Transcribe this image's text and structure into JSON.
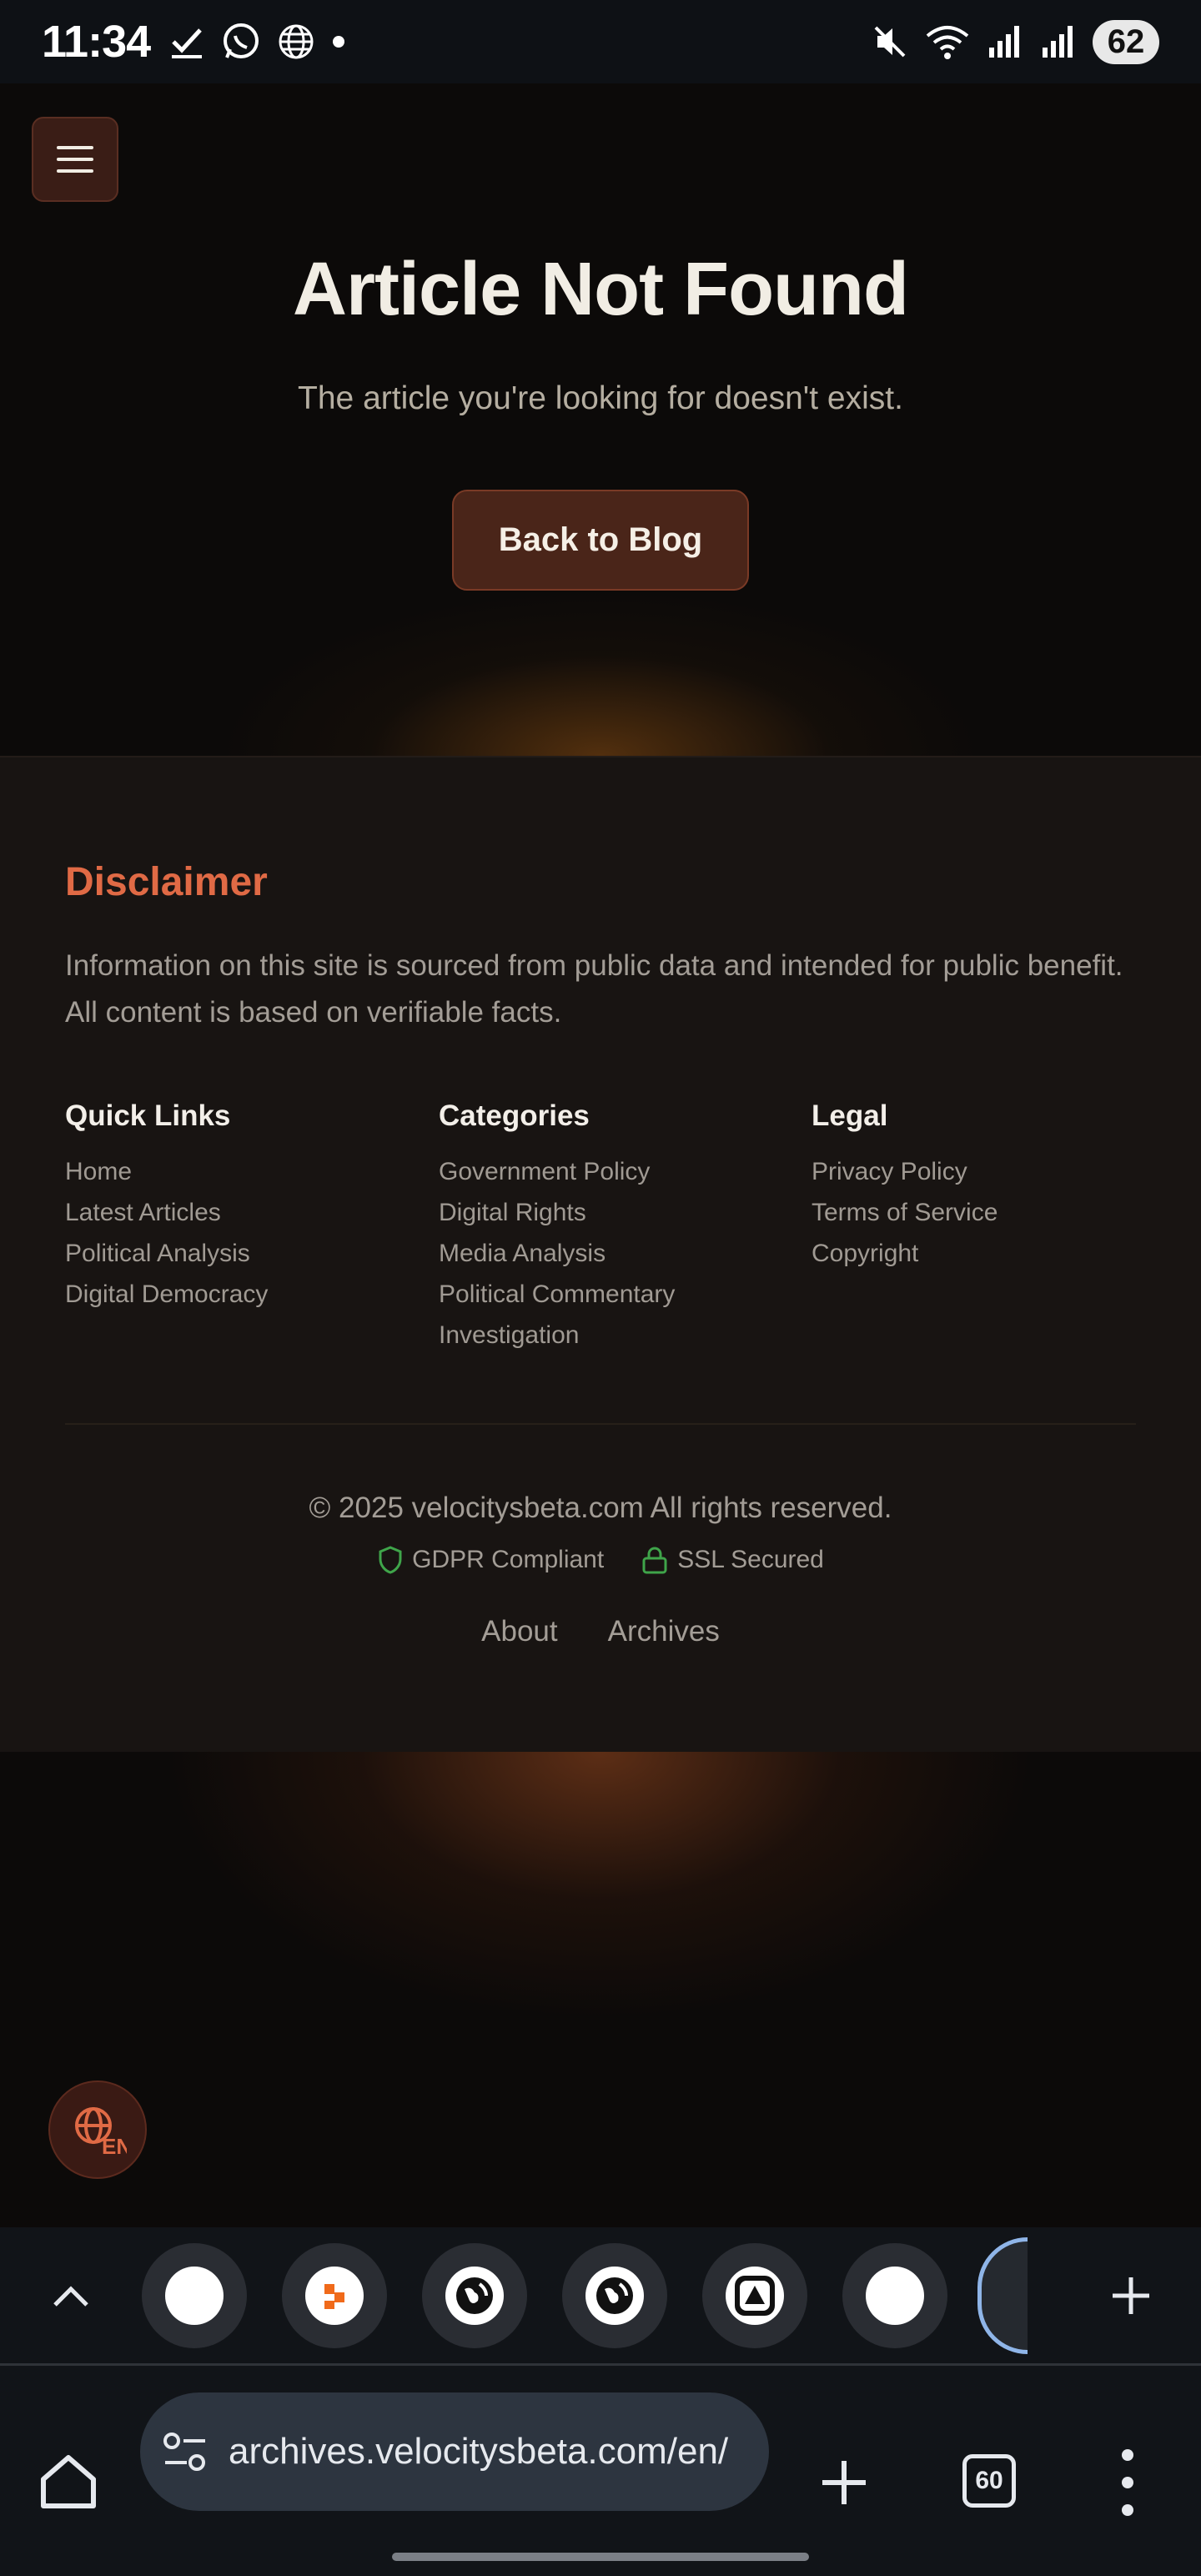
{
  "status_bar": {
    "time": "11:34",
    "left_icons": [
      "check-icon",
      "whatsapp-icon",
      "globe-icon",
      "dot-icon"
    ],
    "right_icons": [
      "mute-icon",
      "wifi-icon",
      "signal-icon",
      "signal-icon"
    ],
    "battery": "62"
  },
  "hero": {
    "title": "Article Not Found",
    "subtitle": "The article you're looking for doesn't exist.",
    "back_button": "Back to Blog"
  },
  "footer": {
    "disclaimer_title": "Disclaimer",
    "disclaimer_text": "Information on this site is sourced from public data and intended for public benefit. All content is based on verifiable facts.",
    "quick_links": {
      "title": "Quick Links",
      "items": [
        "Home",
        "Latest Articles",
        "Political Analysis",
        "Digital Democracy"
      ]
    },
    "categories": {
      "title": "Categories",
      "items": [
        "Government Policy",
        "Digital Rights",
        "Media Analysis",
        "Political Commentary",
        "Investigation"
      ]
    },
    "legal": {
      "title": "Legal",
      "items": [
        "Privacy Policy",
        "Terms of Service",
        "Copyright"
      ]
    },
    "copyright": "© 2025 velocitysbeta.com All rights reserved.",
    "badges": [
      "GDPR Compliant",
      "SSL Secured"
    ],
    "bottom_links": [
      "About",
      "Archives"
    ]
  },
  "language_button": "EN",
  "browser": {
    "url": "archives.velocitysbeta.com/en/",
    "tab_count": "60"
  },
  "colors": {
    "accent": "#e06a45",
    "background": "#0c0a09",
    "footer_bg": "#181412",
    "button_bg": "#4a2519",
    "badge_green": "#3fa54a"
  }
}
